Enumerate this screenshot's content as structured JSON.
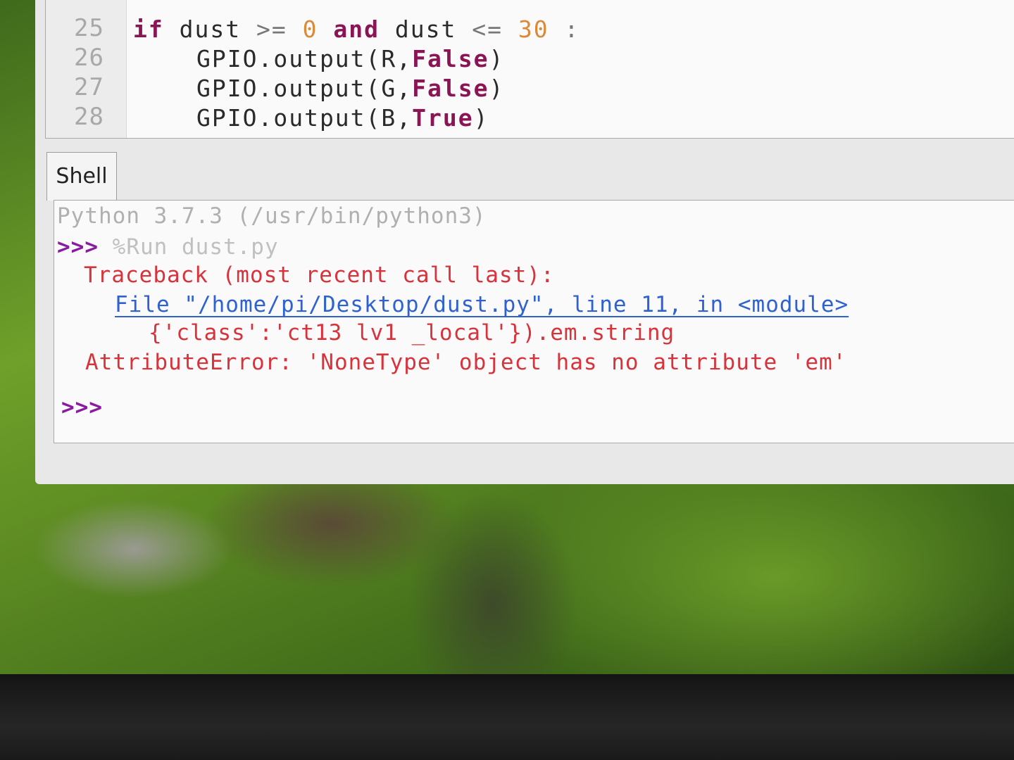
{
  "editor": {
    "lines": [
      {
        "number": "25",
        "kw1": "if",
        "var1": "dust",
        "op1": ">=",
        "num1": "0",
        "kw2": "and",
        "var2": "dust",
        "op2": "<=",
        "num2": "30",
        "tail": ":"
      },
      {
        "number": "26",
        "call": "GPIO.output(R,",
        "arg": "False",
        "close": ")"
      },
      {
        "number": "27",
        "call": "GPIO.output(G,",
        "arg": "False",
        "close": ")"
      },
      {
        "number": "28",
        "call": "GPIO.output(B,",
        "arg": "True",
        "close": ")"
      }
    ]
  },
  "shell": {
    "tab_label": "Shell",
    "banner": "Python 3.7.3 (/usr/bin/python3)",
    "prompt": ">>>",
    "command": "%Run dust.py",
    "traceback_header": "Traceback (most recent call last):",
    "file_link": "File \"/home/pi/Desktop/dust.py\", line 11, in <module>",
    "source_line": "{'class':'ct13 lv1 _local'}).em.string",
    "error_message": "AttributeError: 'NoneType' object has no attribute 'em'",
    "final_prompt": ">>>"
  },
  "colors": {
    "keyword": "#8a1454",
    "number": "#d98a3a",
    "error": "#d8323a",
    "link": "#2e62d0",
    "prompt": "#8a1aa0"
  }
}
